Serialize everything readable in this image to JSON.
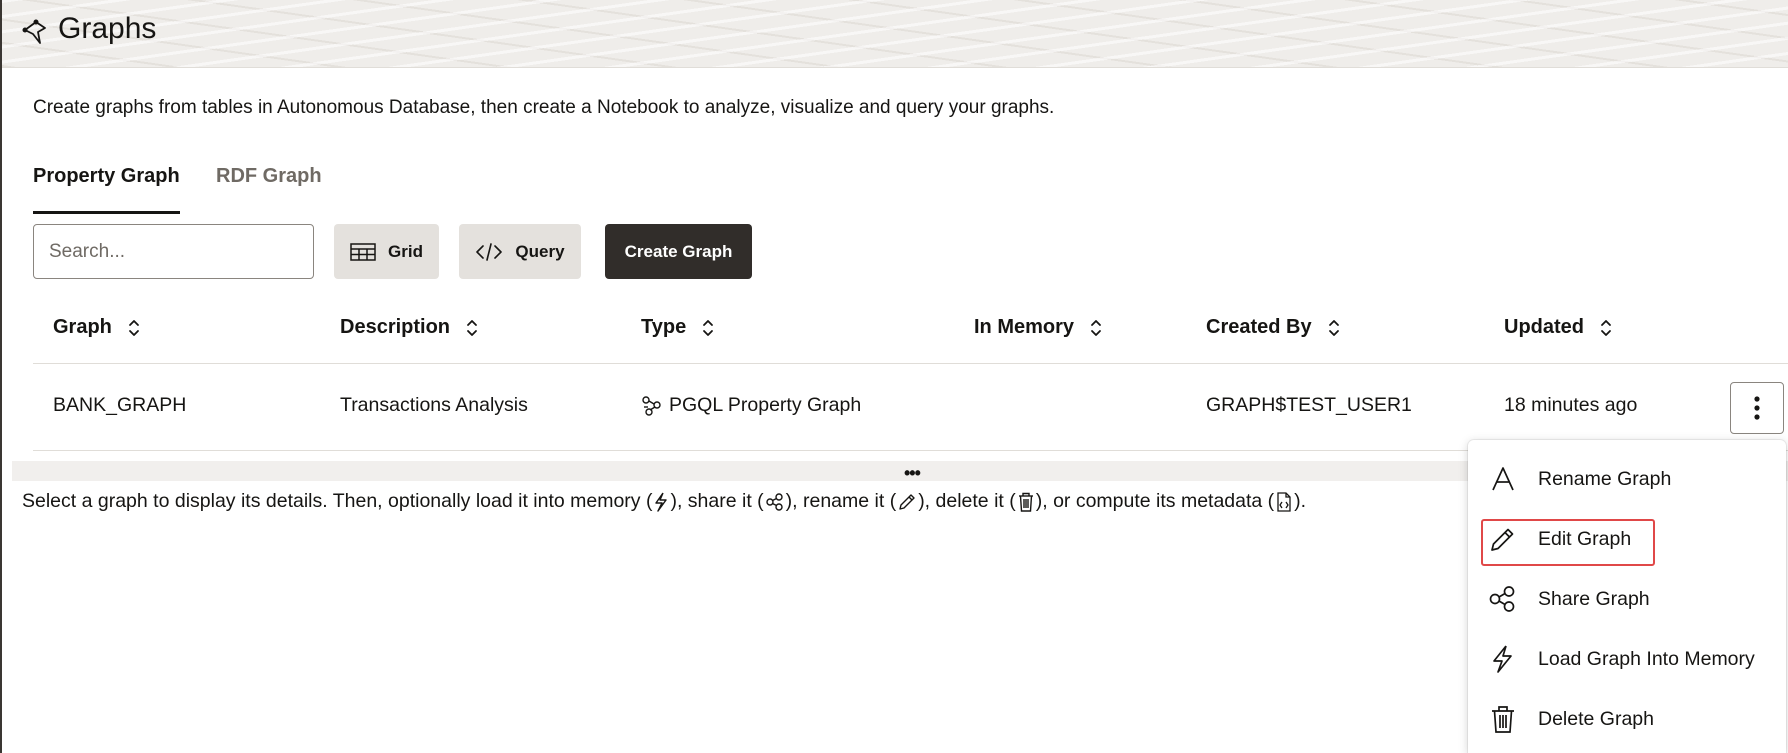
{
  "header": {
    "title": "Graphs",
    "icon": "graph-logo-icon"
  },
  "description": "Create graphs from tables in Autonomous Database, then create a Notebook to analyze, visualize and query your graphs.",
  "tabs": [
    {
      "label": "Property Graph",
      "active": true
    },
    {
      "label": "RDF Graph",
      "active": false
    }
  ],
  "toolbar": {
    "search_placeholder": "Search...",
    "grid_label": "Grid",
    "query_label": "Query",
    "create_label": "Create Graph"
  },
  "table": {
    "columns": [
      "Graph",
      "Description",
      "Type",
      "In Memory",
      "Created By",
      "Updated"
    ],
    "rows": [
      {
        "graph": "BANK_GRAPH",
        "description": "Transactions Analysis",
        "type": "PGQL Property Graph",
        "in_memory": "",
        "created_by": "GRAPH$TEST_USER1",
        "updated": "18 minutes ago"
      }
    ]
  },
  "splitter_dots": "•••",
  "hint": {
    "p1": "Select a graph to display its details. Then, optionally load it into memory (",
    "p2": "), share it (",
    "p3": "), rename it (",
    "p4": "), delete it (",
    "p5": "), or compute its metadata (",
    "p6": ")."
  },
  "context_menu": {
    "items": [
      {
        "label": "Rename Graph",
        "icon": "rename-icon"
      },
      {
        "label": "Edit Graph",
        "icon": "pencil-icon",
        "highlighted": true
      },
      {
        "label": "Share Graph",
        "icon": "share-icon"
      },
      {
        "label": "Load Graph Into Memory",
        "icon": "lightning-icon"
      },
      {
        "label": "Delete Graph",
        "icon": "trash-icon"
      }
    ]
  },
  "colors": {
    "primary_button": "#312d2a",
    "secondary_button": "#e4e1dd",
    "highlight": "#e04848",
    "text": "#161513"
  }
}
